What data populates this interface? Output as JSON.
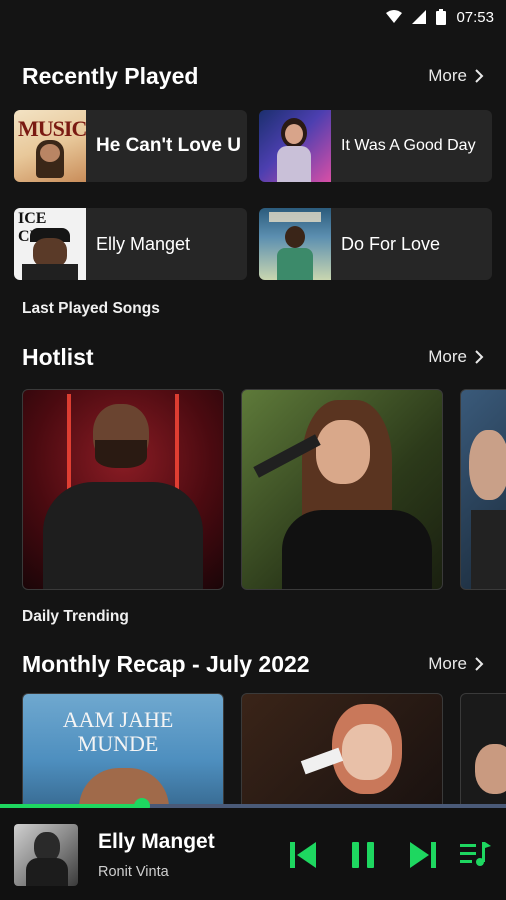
{
  "status_bar": {
    "time": "07:53"
  },
  "recently_played": {
    "title": "Recently Played",
    "more_label": "More",
    "items": [
      {
        "label": "He Can't Love U"
      },
      {
        "label": "It Was A Good Day"
      },
      {
        "label": "Elly Manget"
      },
      {
        "label": "Do For Love"
      }
    ],
    "caption": "Last Played Songs"
  },
  "hotlist": {
    "title": "Hotlist",
    "more_label": "More",
    "caption": "Daily Trending"
  },
  "monthly_recap": {
    "title": "Monthly Recap - July 2022",
    "more_label": "More",
    "cards": [
      {
        "overlay_text": "AAM JAHE MUNDE"
      }
    ]
  },
  "player": {
    "title": "Elly Manget",
    "artist": "Ronit Vinta",
    "progress": 0.28
  },
  "colors": {
    "accent": "#1ed760",
    "background": "#141414",
    "tile": "#262626"
  }
}
